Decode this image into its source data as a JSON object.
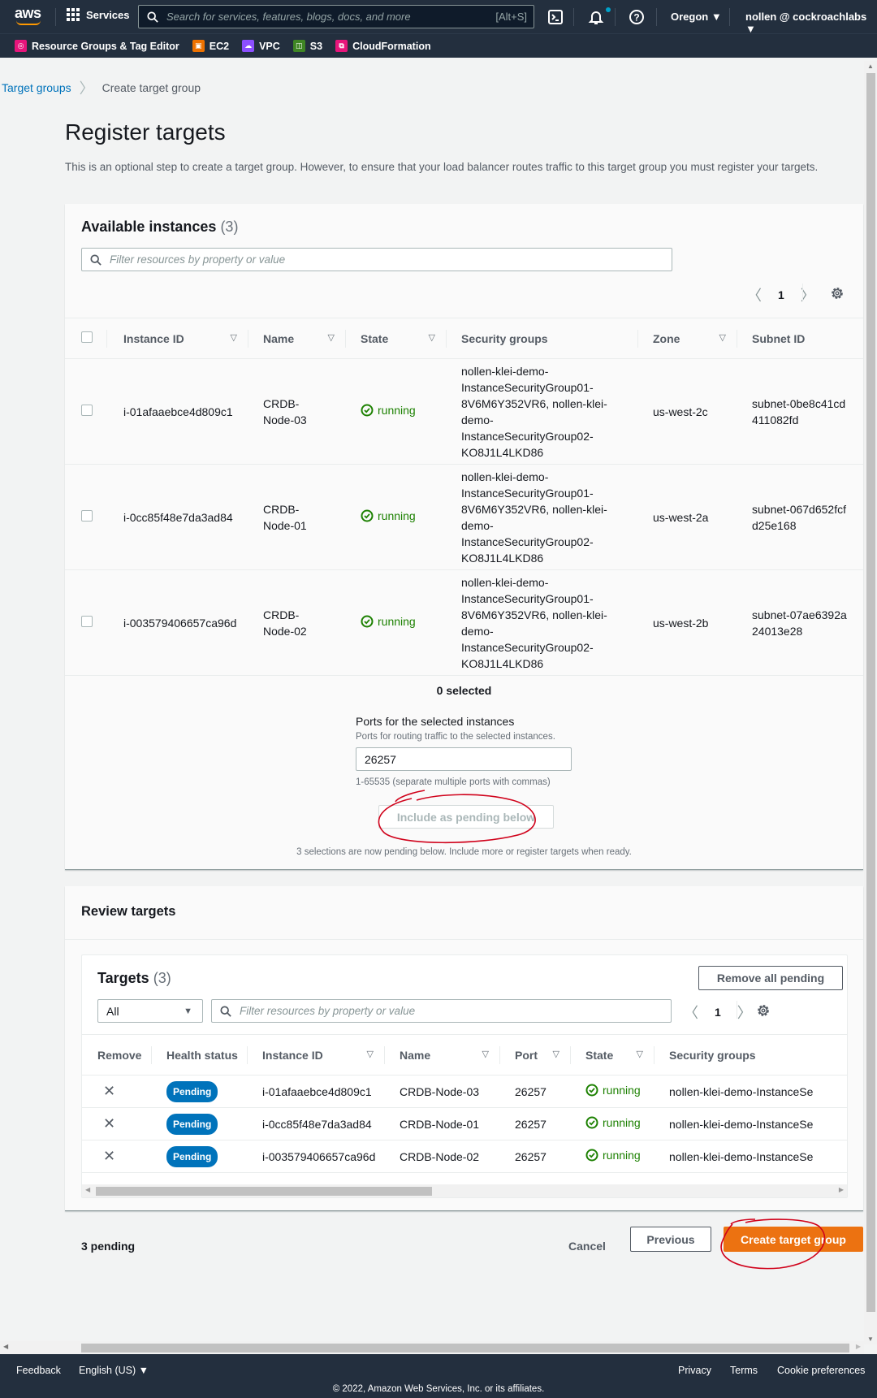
{
  "topnav": {
    "logo": "aws",
    "services_label": "Services",
    "search_placeholder": "Search for services, features, blogs, docs, and more",
    "search_shortcut": "[Alt+S]",
    "region": "Oregon ▼",
    "account": "nollen @ cockroachlabs ▼",
    "icons": [
      "cloudshell-icon",
      "bell-icon",
      "help-icon"
    ]
  },
  "favorites": [
    {
      "label": "Resource Groups & Tag Editor",
      "color": "#e7157b"
    },
    {
      "label": "EC2",
      "color": "#ed7100"
    },
    {
      "label": "VPC",
      "color": "#8c4fff"
    },
    {
      "label": "S3",
      "color": "#3f8624"
    },
    {
      "label": "CloudFormation",
      "color": "#e7157b"
    }
  ],
  "breadcrumb": {
    "parent": "Target groups",
    "current": "Create target group"
  },
  "page": {
    "title": "Register targets",
    "description": "This is an optional step to create a target group. However, to ensure that your load balancer routes traffic to this target group you must register your targets."
  },
  "available": {
    "title": "Available instances",
    "count": "(3)",
    "filter_placeholder": "Filter resources by property or value",
    "page": "1",
    "columns": [
      "Instance ID",
      "Name",
      "State",
      "Security groups",
      "Zone",
      "Subnet ID"
    ],
    "rows": [
      {
        "instance_id": "i-01afaaebce4d809c1",
        "name": "CRDB-Node-03",
        "state": "running",
        "security_groups": "nollen-klei-demo-InstanceSecurityGroup01-8V6M6Y352VR6, nollen-klei-demo-InstanceSecurityGroup02-KO8J1L4LKD86",
        "zone": "us-west-2c",
        "subnet": "subnet-0be8c41cd411082fd"
      },
      {
        "instance_id": "i-0cc85f48e7da3ad84",
        "name": "CRDB-Node-01",
        "state": "running",
        "security_groups": "nollen-klei-demo-InstanceSecurityGroup01-8V6M6Y352VR6, nollen-klei-demo-InstanceSecurityGroup02-KO8J1L4LKD86",
        "zone": "us-west-2a",
        "subnet": "subnet-067d652fcfd25e168"
      },
      {
        "instance_id": "i-003579406657ca96d",
        "name": "CRDB-Node-02",
        "state": "running",
        "security_groups": "nollen-klei-demo-InstanceSecurityGroup01-8V6M6Y352VR6, nollen-klei-demo-InstanceSecurityGroup02-KO8J1L4LKD86",
        "zone": "us-west-2b",
        "subnet": "subnet-07ae6392a24013e28"
      }
    ],
    "selected_count": "0 selected",
    "ports_label": "Ports for the selected instances",
    "ports_desc": "Ports for routing traffic to the selected instances.",
    "ports_value": "26257",
    "ports_hint": "1-65535 (separate multiple ports with commas)",
    "include_button": "Include as pending below",
    "pending_note": "3 selections are now pending below. Include more or register targets when ready."
  },
  "review": {
    "title": "Review targets",
    "targets_title": "Targets",
    "targets_count": "(3)",
    "remove_all_button": "Remove all pending",
    "filter_select": "All",
    "filter_placeholder": "Filter resources by property or value",
    "page": "1",
    "columns": [
      "Remove",
      "Health status",
      "Instance ID",
      "Name",
      "Port",
      "State",
      "Security groups"
    ],
    "rows": [
      {
        "health": "Pending",
        "instance_id": "i-01afaaebce4d809c1",
        "name": "CRDB-Node-03",
        "port": "26257",
        "state": "running",
        "security_groups": "nollen-klei-demo-InstanceSe"
      },
      {
        "health": "Pending",
        "instance_id": "i-0cc85f48e7da3ad84",
        "name": "CRDB-Node-01",
        "port": "26257",
        "state": "running",
        "security_groups": "nollen-klei-demo-InstanceSe"
      },
      {
        "health": "Pending",
        "instance_id": "i-003579406657ca96d",
        "name": "CRDB-Node-02",
        "port": "26257",
        "state": "running",
        "security_groups": "nollen-klei-demo-InstanceSe"
      }
    ]
  },
  "actions": {
    "pending_count": "3 pending",
    "cancel": "Cancel",
    "previous": "Previous",
    "create": "Create target group"
  },
  "footer": {
    "feedback": "Feedback",
    "language": "English (US) ▼",
    "privacy": "Privacy",
    "terms": "Terms",
    "cookies": "Cookie preferences",
    "copyright": "© 2022, Amazon Web Services, Inc. or its affiliates."
  },
  "colors": {
    "nav_bg": "#232f3e",
    "link": "#0073bb",
    "running": "#1d8102",
    "pending_badge": "#0073bb",
    "primary_button": "#ec7211",
    "annotation": "#d0021b"
  }
}
